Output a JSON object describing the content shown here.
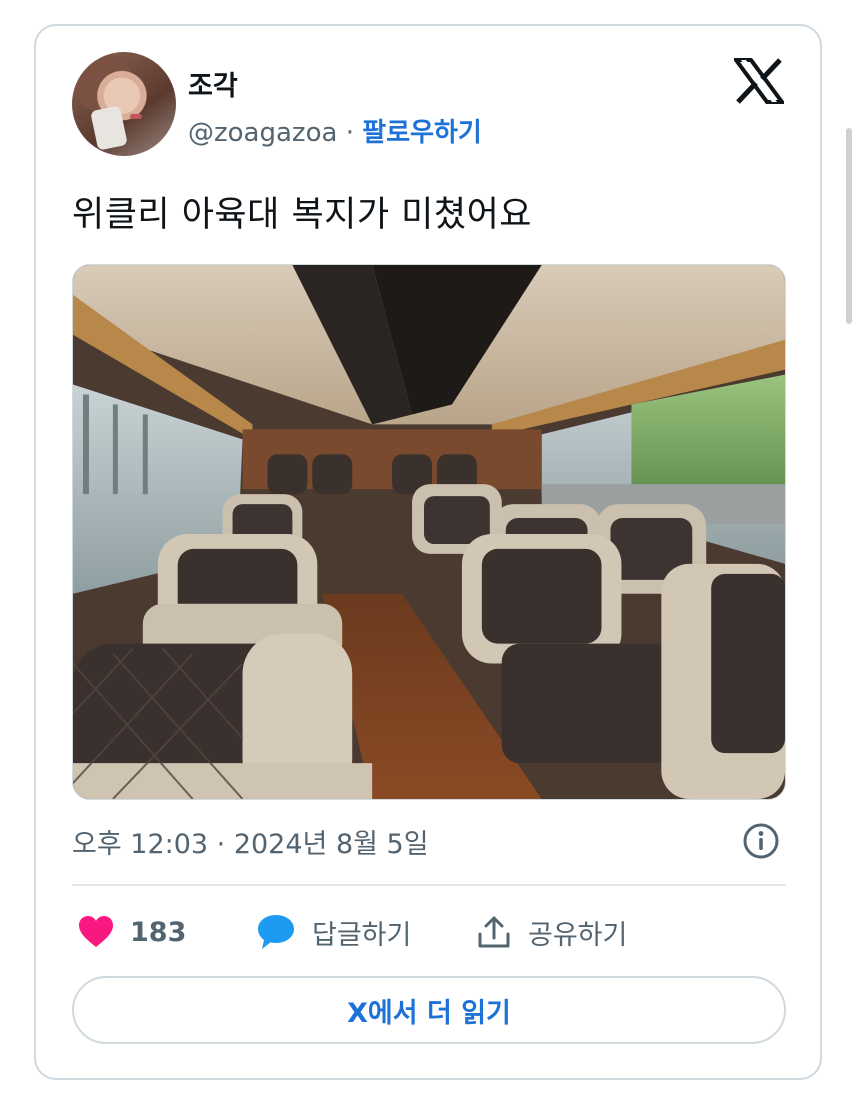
{
  "author": {
    "display_name": "조각",
    "handle": "@zoagazoa",
    "separator": "·",
    "follow_label": "팔로우하기"
  },
  "tweet": {
    "text": "위클리 아육대 복지가 미쳤어요",
    "timestamp": "오후 12:03 · 2024년 8월 5일"
  },
  "actions": {
    "like_count": "183",
    "reply_label": "답글하기",
    "share_label": "공유하기"
  },
  "read_more_label": "X에서 더 읽기",
  "icons": {
    "logo": "x-logo-icon",
    "info": "info-icon",
    "like": "heart-icon",
    "reply": "speech-bubble-icon",
    "share": "share-upload-icon"
  },
  "colors": {
    "heart": "#f91880",
    "reply_bubble": "#1d9bf0",
    "link": "#1d72d8",
    "border": "#cfd9de",
    "muted_text": "#536471"
  }
}
